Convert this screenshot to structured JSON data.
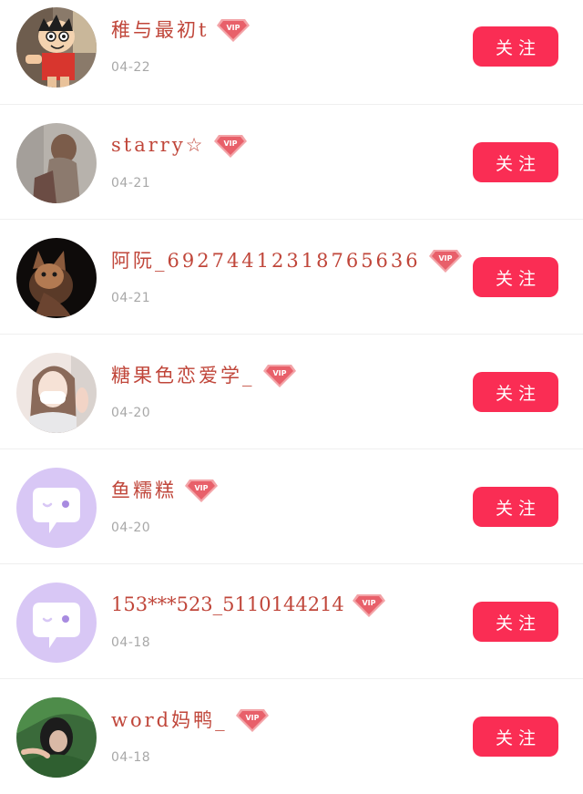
{
  "followers": [
    {
      "name": "稚与最初t",
      "date": "04-22",
      "follow_label": "关注",
      "vip": true,
      "avatar": "cartoon-boy-avatar"
    },
    {
      "name": "starry☆",
      "date": "04-21",
      "follow_label": "关注",
      "vip": true,
      "avatar": "girl-back-photo-avatar"
    },
    {
      "name": "阿阮_69274412318765636",
      "date": "04-21",
      "follow_label": "关注",
      "vip": true,
      "avatar": "kitten-photo-avatar"
    },
    {
      "name": "糖果色恋爱学_",
      "date": "04-20",
      "follow_label": "关注",
      "vip": true,
      "avatar": "girl-mask-photo-avatar"
    },
    {
      "name": "鱼糯糕",
      "date": "04-20",
      "follow_label": "关注",
      "vip": true,
      "avatar": "default-chat-avatar"
    },
    {
      "name": "153***523_5110144214",
      "date": "04-18",
      "follow_label": "关注",
      "vip": true,
      "avatar": "default-chat-avatar"
    },
    {
      "name": "word妈鸭_",
      "date": "04-18",
      "follow_label": "关注",
      "vip": true,
      "avatar": "girl-green-hoodie-avatar"
    }
  ],
  "colors": {
    "follow_button": "#fa2d54",
    "name_text": "#c0463a",
    "date_text": "#a8a8a8",
    "vip_badge": "#e8606a"
  }
}
